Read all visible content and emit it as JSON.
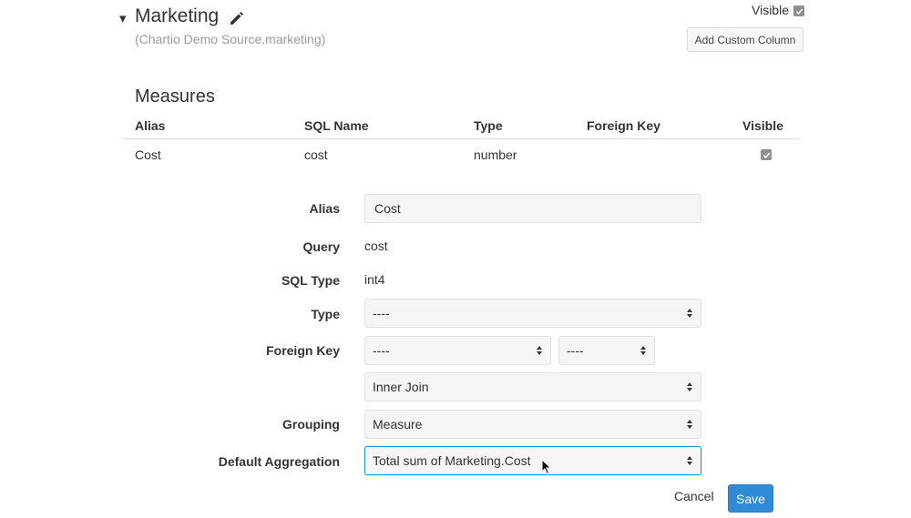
{
  "header": {
    "caret": "▾",
    "title": "Marketing",
    "subtitle": "(Chartio Demo Source.marketing)",
    "visible_label": "Visible",
    "visible_checked": true,
    "add_custom_column_label": "Add Custom Column",
    "edit_icon": "pencil-icon"
  },
  "measures": {
    "section_title": "Measures",
    "columns": [
      "Alias",
      "SQL Name",
      "Type",
      "Foreign Key",
      "Visible"
    ],
    "rows": [
      {
        "alias": "Cost",
        "sql_name": "cost",
        "type": "number",
        "foreign_key": "",
        "visible": true
      }
    ]
  },
  "form": {
    "alias": {
      "label": "Alias",
      "value": "Cost"
    },
    "query": {
      "label": "Query",
      "value": "cost"
    },
    "sql_type": {
      "label": "SQL Type",
      "value": "int4"
    },
    "type": {
      "label": "Type",
      "value": "----"
    },
    "foreign_key": {
      "label": "Foreign Key",
      "table_value": "----",
      "column_value": "----",
      "join_value": "Inner Join"
    },
    "grouping": {
      "label": "Grouping",
      "value": "Measure"
    },
    "default_aggregation": {
      "label": "Default Aggregation",
      "value": "Total sum of Marketing.Cost"
    },
    "cancel_label": "Cancel",
    "save_label": "Save"
  },
  "colors": {
    "accent": "#2f8bd5",
    "focus_border": "#2d8fd5",
    "checkbox": "#8f8f8f",
    "muted_text": "#9a9a9a"
  }
}
